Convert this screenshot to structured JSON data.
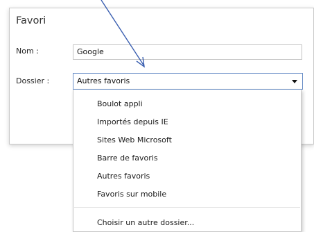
{
  "dialog": {
    "title": "Favori",
    "name_label": "Nom :",
    "name_value": "Google",
    "folder_label": "Dossier :",
    "folder_value": "Autres favoris"
  },
  "dropdown": {
    "items": [
      "Boulot appli",
      "Importés depuis IE",
      "Sites Web Microsoft",
      "Barre de favoris",
      "Autres favoris",
      "Favoris sur mobile"
    ],
    "choose_other": "Choisir un autre dossier..."
  },
  "annotation": {
    "arrow_color": "#3a5fb0"
  }
}
